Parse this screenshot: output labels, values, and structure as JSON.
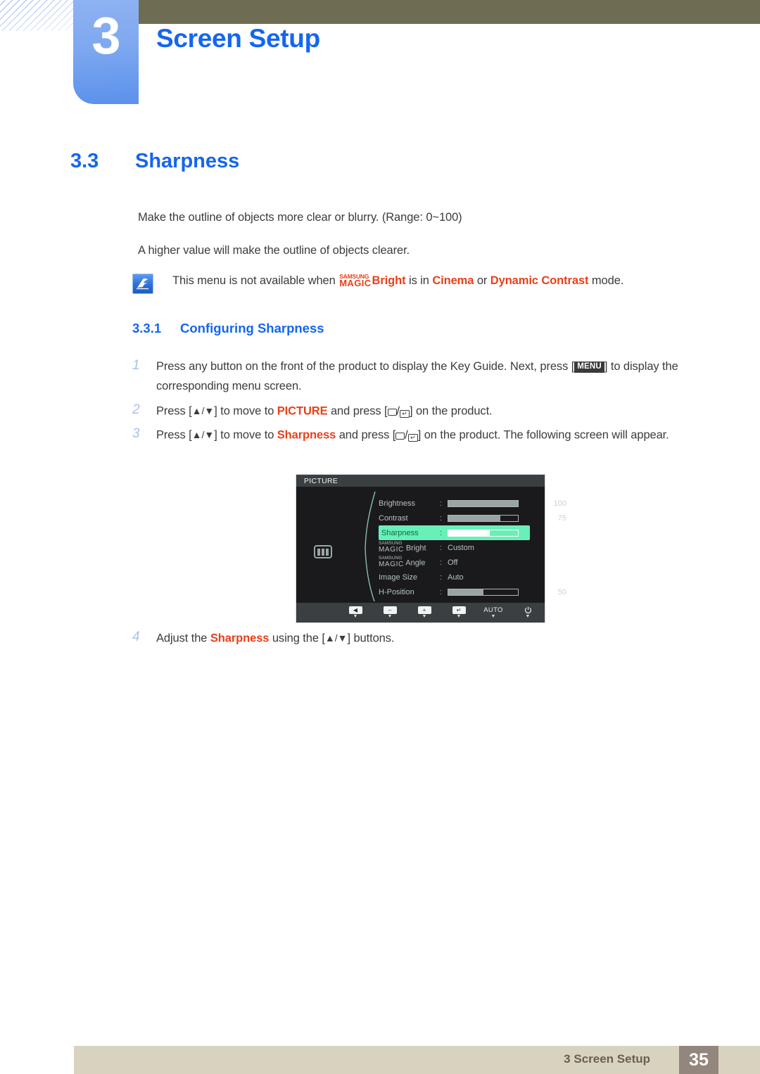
{
  "header": {
    "chapter_number": "3",
    "chapter_title": "Screen Setup"
  },
  "section": {
    "number": "3.3",
    "title": "Sharpness"
  },
  "paragraphs": {
    "p1": "Make the outline of objects more clear or blurry. (Range: 0~100)",
    "p2": "A higher value will make the outline of objects clearer."
  },
  "note": {
    "icon": "note-pen-icon",
    "text_before": "This menu is not available when",
    "magic_top": "SAMSUNG",
    "magic_bottom": "MAGIC",
    "magic_suffix": "Bright",
    "text_mid": "is in",
    "mode_1": "Cinema",
    "text_or": "or",
    "mode_2": "Dynamic Contrast",
    "text_after": "mode."
  },
  "subsection": {
    "number": "3.3.1",
    "title": "Configuring Sharpness"
  },
  "steps": {
    "s1": {
      "num": "1",
      "part_a": "Press any button on the front of the product to display the Key Guide. Next, press [",
      "keycap": "MENU",
      "part_b": "] to display the corresponding menu screen."
    },
    "s2": {
      "num": "2",
      "part_a": "Press [",
      "arrows": "▲/▼",
      "part_b": "] to move to",
      "highlight": "PICTURE",
      "part_c": "and press [",
      "part_d": "] on the product."
    },
    "s3": {
      "num": "3",
      "part_a": "Press [",
      "arrows": "▲/▼",
      "part_b": "] to move to",
      "highlight": "Sharpness",
      "part_c": "and press [",
      "part_d": "] on the product. The following screen will appear."
    },
    "s4": {
      "num": "4",
      "part_a": "Adjust the",
      "highlight": "Sharpness",
      "part_b": "using the [",
      "arrows": "▲/▼",
      "part_c": "] buttons."
    }
  },
  "osd": {
    "title": "PICTURE",
    "left_icon": "picture-brightness-icon",
    "rows": [
      {
        "label": "Brightness",
        "colon": ":",
        "type": "slider",
        "value": "100",
        "fill_pct": 100
      },
      {
        "label": "Contrast",
        "colon": ":",
        "type": "slider",
        "value": "75",
        "fill_pct": 75
      },
      {
        "label": "Sharpness",
        "colon": ":",
        "type": "slider",
        "value": "60",
        "fill_pct": 60,
        "selected": true
      },
      {
        "label_top": "SAMSUNG",
        "label_bottom": "MAGIC",
        "label_suffix": "Bright",
        "colon": ":",
        "type": "value",
        "value": "Custom"
      },
      {
        "label_top": "SAMSUNG",
        "label_bottom": "MAGIC",
        "label_suffix": "Angle",
        "colon": ":",
        "type": "value",
        "value": "Off"
      },
      {
        "label": "Image Size",
        "colon": ":",
        "type": "value",
        "value": "Auto"
      },
      {
        "label": "H-Position",
        "colon": ":",
        "type": "slider",
        "value": "50",
        "fill_pct": 50
      }
    ],
    "scroll_down": "▼",
    "buttons": [
      {
        "name": "back-button",
        "glyph": "◀",
        "tick": "▼"
      },
      {
        "name": "minus-button",
        "glyph": "–",
        "tick": "▼"
      },
      {
        "name": "plus-button",
        "glyph": "+",
        "tick": "▼"
      },
      {
        "name": "enter-button",
        "glyph": "↵",
        "tick": "▼"
      },
      {
        "name": "auto-button",
        "glyph": "AUTO",
        "tick": "▼"
      },
      {
        "name": "power-button",
        "glyph": "⏻",
        "tick": "▼"
      }
    ]
  },
  "footer": {
    "text": "3 Screen Setup",
    "page": "35"
  },
  "colors": {
    "accent_blue": "#1466f0",
    "accent_red": "#e8401a",
    "osd_highlight": "#69efb8",
    "header_bar": "#6f6c54",
    "footer_bar": "#d8d3be",
    "footer_page_bg": "#93867c"
  }
}
